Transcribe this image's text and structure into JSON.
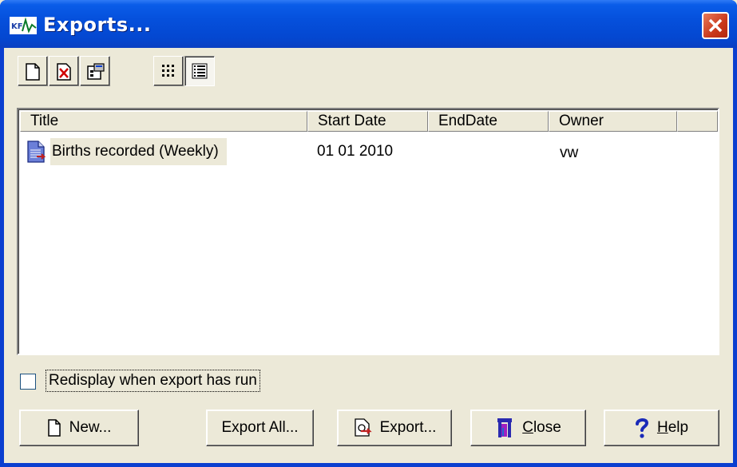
{
  "window": {
    "title": "Exports..."
  },
  "toolbar": {
    "buttons": [
      {
        "name": "new-icon"
      },
      {
        "name": "delete-icon"
      },
      {
        "name": "properties-icon"
      },
      {
        "name": "icon-view-icon"
      },
      {
        "name": "details-view-icon",
        "pressed": true
      }
    ]
  },
  "list": {
    "columns": [
      "Title",
      "Start Date",
      "EndDate",
      "Owner"
    ],
    "rows": [
      {
        "title": "Births recorded (Weekly)",
        "start_date": "01 01 2010",
        "end_date": "",
        "owner": "vw"
      }
    ]
  },
  "options": {
    "redisplay_label": "Redisplay when export has run",
    "redisplay_checked": false
  },
  "buttons": {
    "new": "New...",
    "export_all": "Export All...",
    "export": "Export...",
    "close_prefix": "C",
    "close_rest": "lose",
    "help_prefix": "H",
    "help_rest": "elp"
  }
}
